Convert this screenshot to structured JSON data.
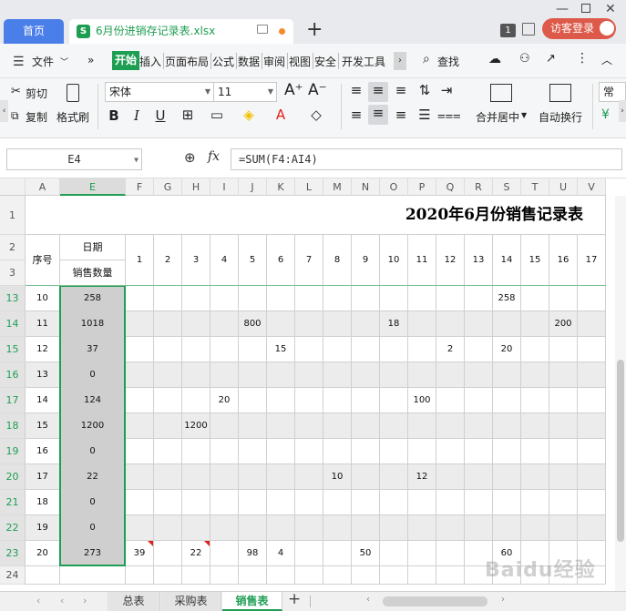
{
  "window": {
    "home_tab": "首页",
    "file_tab": "6月份进销存记录表.xlsx",
    "xls_icon_glyph": "S",
    "new_tab": "+",
    "badge": "1",
    "login": "访客登录"
  },
  "menu": {
    "file": "文件",
    "items": [
      "开始",
      "插入",
      "页面布局",
      "公式",
      "数据",
      "审阅",
      "视图",
      "安全",
      "开发工具"
    ],
    "search": "查找"
  },
  "toolbar": {
    "cut": "剪切",
    "copy": "复制",
    "format_painter": "格式刷",
    "font_name": "宋体",
    "font_size": "11",
    "merge": "合并居中",
    "wrap": "自动换行",
    "right_edge": "常"
  },
  "formula_bar": {
    "cell_ref": "E4",
    "fx": "fx",
    "formula": "=SUM(F4:AI4)"
  },
  "sheet": {
    "title": "2020年6月份销售记录表",
    "columns": [
      "A",
      "E",
      "F",
      "G",
      "H",
      "I",
      "J",
      "K",
      "L",
      "M",
      "N",
      "O",
      "P",
      "Q",
      "R",
      "S",
      "T",
      "U",
      "V"
    ],
    "header": {
      "seq": "序号",
      "date": "日期",
      "sales_qty": "销售数量",
      "days": [
        "1",
        "2",
        "3",
        "4",
        "5",
        "6",
        "7",
        "8",
        "9",
        "10",
        "11",
        "12",
        "13",
        "14",
        "15",
        "16",
        "17"
      ]
    },
    "rows": [
      {
        "rownum": "13",
        "seq": "10",
        "total": "258",
        "vals": {
          "14": "258"
        }
      },
      {
        "rownum": "14",
        "seq": "11",
        "total": "1018",
        "vals": {
          "5": "800",
          "10": "18",
          "16": "200"
        }
      },
      {
        "rownum": "15",
        "seq": "12",
        "total": "37",
        "vals": {
          "6": "15",
          "12": "2",
          "14": "20"
        }
      },
      {
        "rownum": "16",
        "seq": "13",
        "total": "0",
        "vals": {}
      },
      {
        "rownum": "17",
        "seq": "14",
        "total": "124",
        "vals": {
          "4": "20",
          "11": "100"
        }
      },
      {
        "rownum": "18",
        "seq": "15",
        "total": "1200",
        "vals": {
          "3": "1200"
        }
      },
      {
        "rownum": "19",
        "seq": "16",
        "total": "0",
        "vals": {}
      },
      {
        "rownum": "20",
        "seq": "17",
        "total": "22",
        "vals": {
          "8": "10",
          "11": "12"
        }
      },
      {
        "rownum": "21",
        "seq": "18",
        "total": "0",
        "vals": {}
      },
      {
        "rownum": "22",
        "seq": "19",
        "total": "0",
        "vals": {}
      },
      {
        "rownum": "23",
        "seq": "20",
        "total": "273",
        "vals": {
          "1": "39",
          "3": "22",
          "5": "98",
          "6": "4",
          "9": "50",
          "14": "60"
        }
      }
    ],
    "comment_days_row23": [
      "1",
      "3"
    ],
    "header_rows": [
      "1",
      "2",
      "3"
    ],
    "last_row": "24"
  },
  "sheets": {
    "tabs": [
      "总表",
      "采购表",
      "销售表"
    ],
    "active": "销售表",
    "add": "+"
  },
  "watermark": "Baidu经验",
  "colors": {
    "accent_green": "#1e9e52",
    "home_blue": "#4a7ee8",
    "login_red": "#dd5a4a",
    "selection_border": "#1e9e52"
  }
}
